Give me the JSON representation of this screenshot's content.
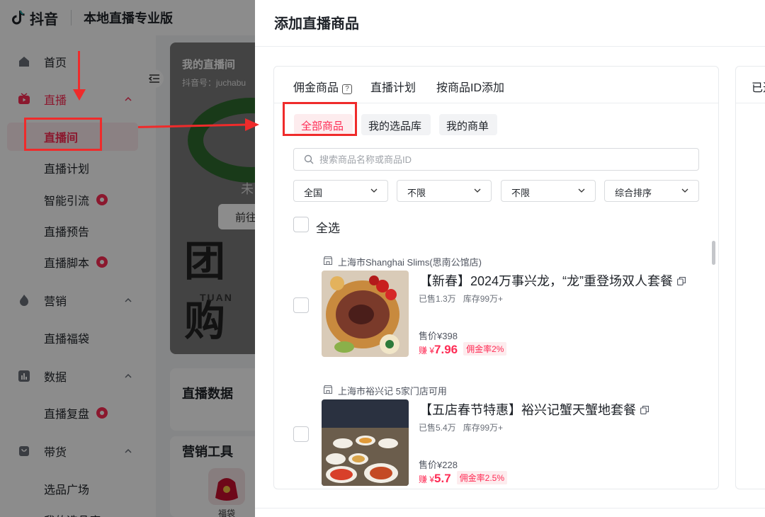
{
  "brand": {
    "logo_text": "抖音",
    "product_title": "本地直播专业版",
    "accent": "#fe2c55"
  },
  "sidebar": {
    "groups": [
      {
        "label": "首页"
      },
      {
        "label": "直播"
      },
      {
        "label": "营销"
      },
      {
        "label": "数据"
      },
      {
        "label": "带货"
      }
    ],
    "items": [
      {
        "label": "直播间",
        "active": true
      },
      {
        "label": "直播计划"
      },
      {
        "label": "智能引流",
        "badge": true
      },
      {
        "label": "直播预告"
      },
      {
        "label": "直播脚本",
        "badge": true
      },
      {
        "label": "直播福袋"
      },
      {
        "label": "直播复盘",
        "badge": true
      },
      {
        "label": "选品广场"
      },
      {
        "label": "我的选品库"
      }
    ]
  },
  "main": {
    "hero": {
      "title": "我的直播间",
      "subtitle": "抖音号：juchabu",
      "status_text": "未",
      "go_button": "前往",
      "banner_text": "团购",
      "banner_sub": "TUAN"
    },
    "data_card_title": "直播数据",
    "tools_card_title": "营销工具",
    "tool_label": "福袋"
  },
  "drawer": {
    "title": "添加直播商品",
    "tabs": [
      "佣金商品",
      "直播计划",
      "按商品ID添加"
    ],
    "help_glyph": "?",
    "subtabs": [
      "全部商品",
      "我的选品库",
      "我的商单"
    ],
    "search_placeholder": "搜索商品名称或商品ID",
    "filters": [
      "全国",
      "不限",
      "不限",
      "综合排序"
    ],
    "select_all": "全选",
    "right_panel_tab": "已选"
  },
  "products": [
    {
      "shop": "上海市Shanghai Slims(思南公馆店)",
      "title": "【新春】2024万事兴龙，“龙”重登场双人套餐",
      "sold": "已售1.3万",
      "stock": "库存99万+",
      "price": "售价¥398",
      "earn_prefix": "赚 ¥",
      "earn_value": "7.96",
      "commission": "佣金率2%"
    },
    {
      "shop": "上海市裕兴记 5家门店可用",
      "title": "【五店春节特惠】裕兴记蟹天蟹地套餐",
      "sold": "已售5.4万",
      "stock": "库存99万+",
      "price": "售价¥228",
      "earn_prefix": "赚 ¥",
      "earn_value": "5.7",
      "commission": "佣金率2.5%"
    }
  ]
}
